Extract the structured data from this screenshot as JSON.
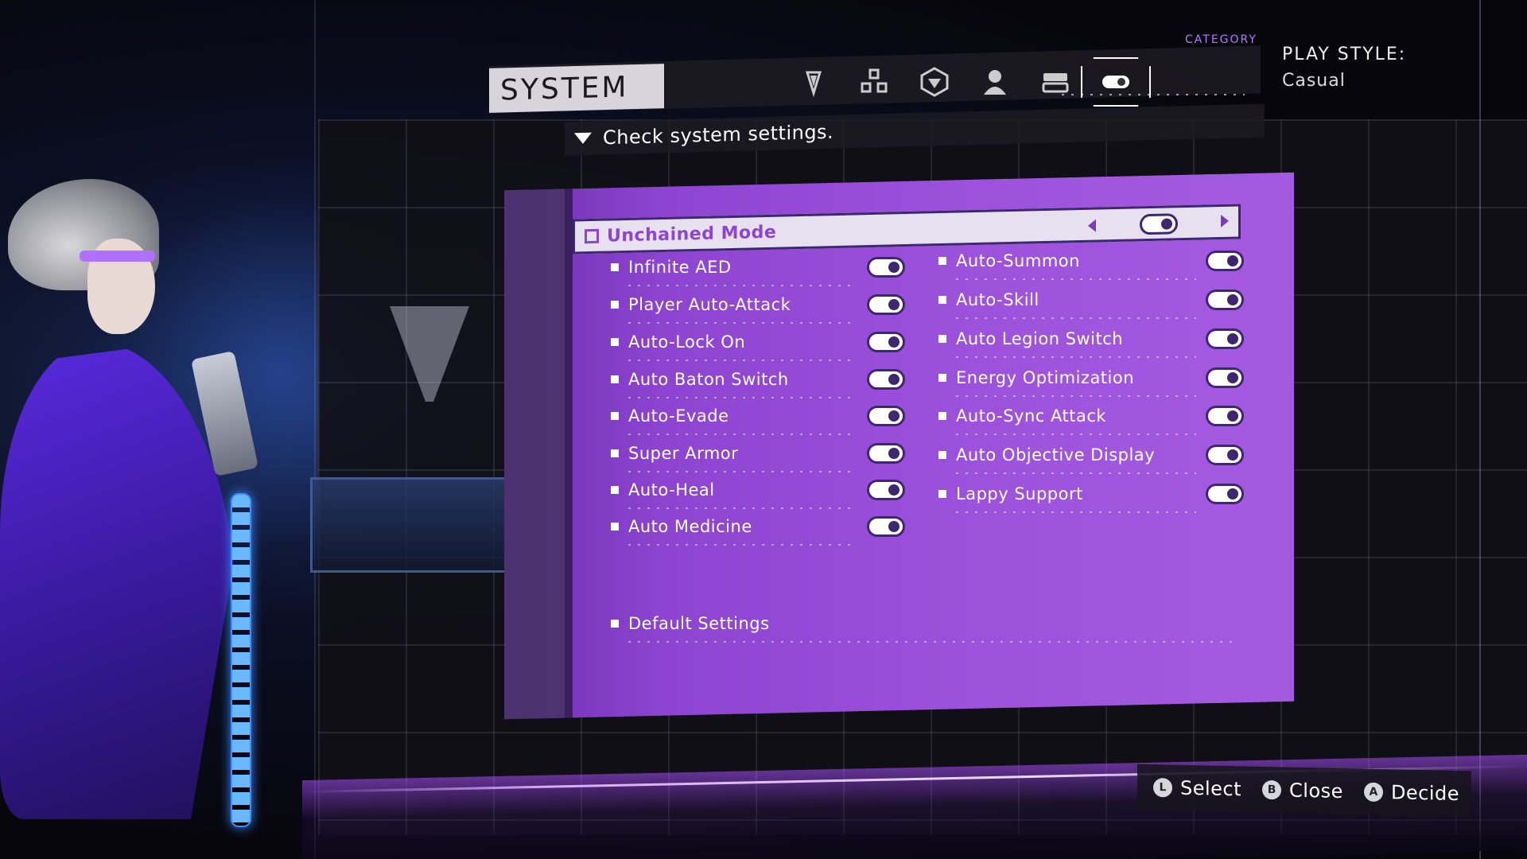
{
  "header": {
    "title": "SYSTEM",
    "subtitle": "Check system settings.",
    "category_label": "CATEGORY",
    "tabs": [
      {
        "icon": "sword-icon",
        "active": false
      },
      {
        "icon": "grid-icon",
        "active": false
      },
      {
        "icon": "shield-emblem-icon",
        "active": false
      },
      {
        "icon": "person-icon",
        "active": false
      },
      {
        "icon": "card-icon",
        "active": false
      },
      {
        "icon": "toggle-icon",
        "active": true
      }
    ]
  },
  "play_style": {
    "label": "PLAY STYLE:",
    "value": "Casual"
  },
  "highlight": {
    "label": "Unchained Mode",
    "enabled": true
  },
  "left_options": [
    {
      "label": "Infinite AED",
      "enabled": true
    },
    {
      "label": "Player Auto-Attack",
      "enabled": true
    },
    {
      "label": "Auto-Lock On",
      "enabled": true
    },
    {
      "label": "Auto Baton Switch",
      "enabled": true
    },
    {
      "label": "Auto-Evade",
      "enabled": true
    },
    {
      "label": "Super Armor",
      "enabled": true
    },
    {
      "label": "Auto-Heal",
      "enabled": true
    },
    {
      "label": "Auto Medicine",
      "enabled": true
    }
  ],
  "right_options": [
    {
      "label": "Auto-Summon",
      "enabled": true
    },
    {
      "label": "Auto-Skill",
      "enabled": true
    },
    {
      "label": "Auto Legion Switch",
      "enabled": true
    },
    {
      "label": "Energy Optimization",
      "enabled": true
    },
    {
      "label": "Auto-Sync Attack",
      "enabled": true
    },
    {
      "label": "Auto Objective Display",
      "enabled": true
    },
    {
      "label": "Lappy Support",
      "enabled": true
    }
  ],
  "default_settings": "Default Settings",
  "footer": [
    {
      "button": "L",
      "label": "Select"
    },
    {
      "button": "B",
      "label": "Close"
    },
    {
      "button": "A",
      "label": "Decide"
    }
  ],
  "colors": {
    "panel": "#9d52dc",
    "accent": "#8d44d0",
    "dark": "#3d2770"
  }
}
